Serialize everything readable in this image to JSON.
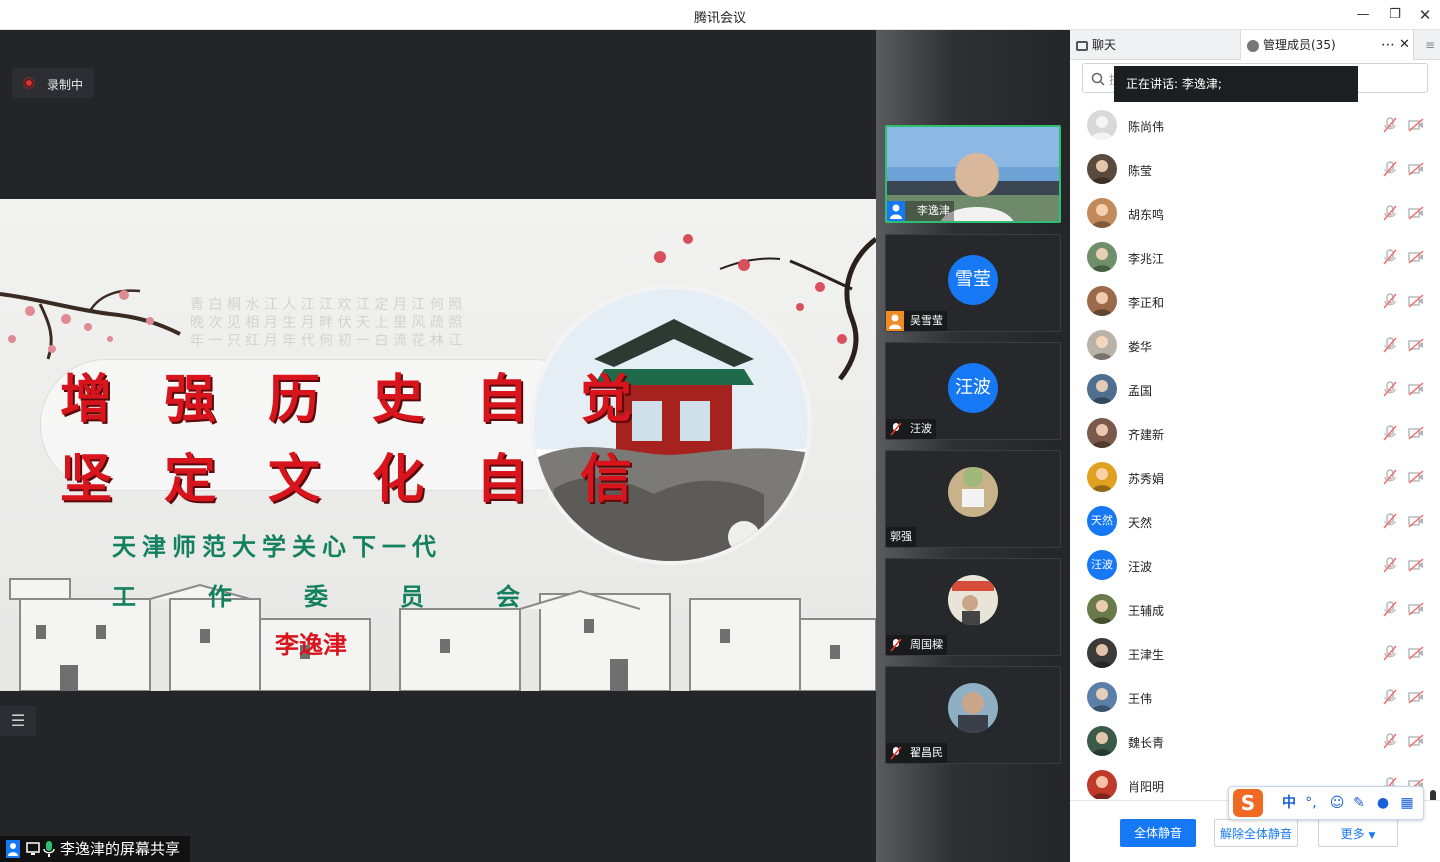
{
  "window": {
    "title": "腾讯会议"
  },
  "stage": {
    "recording_label": "录制中",
    "share_label": "李逸津的屏幕共享"
  },
  "slide": {
    "line1": "增强历史自觉",
    "line2": "坚定文化自信",
    "org_line1": "天津师范大学关心下一代",
    "org_line2": "工作委员会",
    "author": "李逸津"
  },
  "gallery": [
    {
      "name": "李逸津",
      "type": "video"
    },
    {
      "name": "吴雪莹",
      "type": "initials",
      "initials": "雪莹"
    },
    {
      "name": "汪波",
      "type": "initials",
      "initials": "汪波"
    },
    {
      "name": "郭强",
      "type": "photo"
    },
    {
      "name": "周国樑",
      "type": "photo"
    },
    {
      "name": "翟昌民",
      "type": "photo"
    }
  ],
  "panel": {
    "tab_chat": "聊天",
    "tab_members": "管理成员(35)",
    "search_placeholder": "搜",
    "speaking_tooltip": "正在讲话: 李逸津;",
    "members": [
      {
        "name": "陈尚伟",
        "avatar": "default"
      },
      {
        "name": "陈莹",
        "avatar": "photo"
      },
      {
        "name": "胡东鸣",
        "avatar": "photo"
      },
      {
        "name": "李兆江",
        "avatar": "photo"
      },
      {
        "name": "李正和",
        "avatar": "photo"
      },
      {
        "name": "娄华",
        "avatar": "photo"
      },
      {
        "name": "孟国",
        "avatar": "photo"
      },
      {
        "name": "齐建新",
        "avatar": "photo"
      },
      {
        "name": "苏秀娟",
        "avatar": "photo"
      },
      {
        "name": "天然",
        "avatar": "initials",
        "initials": "天然"
      },
      {
        "name": "汪波",
        "avatar": "initials",
        "initials": "汪波"
      },
      {
        "name": "王辅成",
        "avatar": "photo"
      },
      {
        "name": "王津生",
        "avatar": "photo"
      },
      {
        "name": "王伟",
        "avatar": "photo"
      },
      {
        "name": "魏长青",
        "avatar": "photo"
      },
      {
        "name": "肖阳明",
        "avatar": "photo"
      }
    ],
    "mute_all": "全体静音",
    "unmute_all": "解除全体静音",
    "more": "更多"
  },
  "ime": {
    "mode": "中",
    "punct": "°,"
  },
  "colors": {
    "accent": "#1678f5",
    "slide_red": "#d8141c",
    "slide_green": "#13805e",
    "speaking_border": "#2fbf71"
  }
}
